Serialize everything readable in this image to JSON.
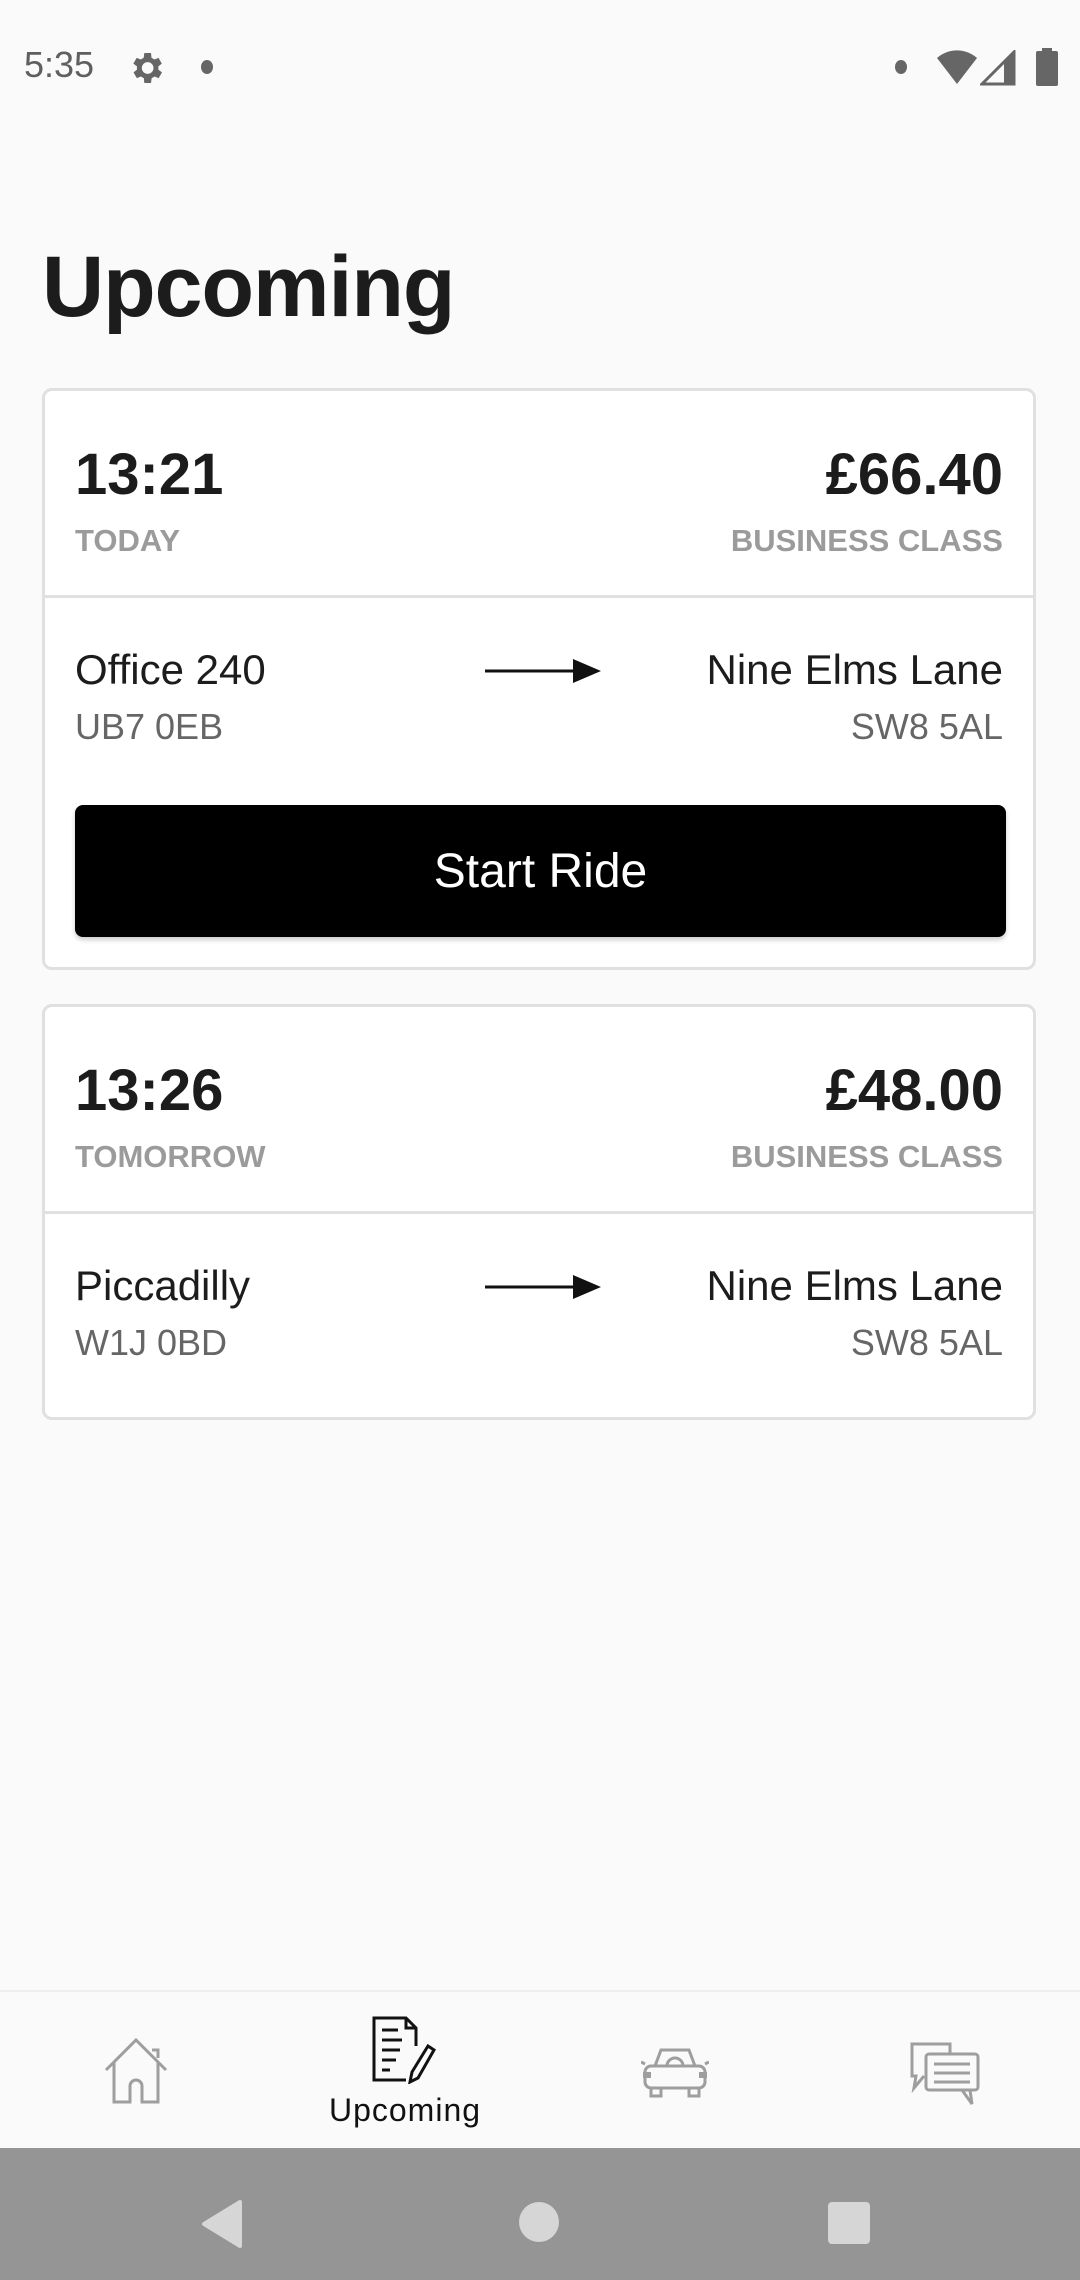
{
  "status_bar": {
    "time": "5:35",
    "icons": [
      "gear-icon",
      "notification-dot",
      "notification-dot",
      "wifi-icon",
      "signal-icon",
      "battery-icon"
    ]
  },
  "page": {
    "title": "Upcoming"
  },
  "rides": [
    {
      "time": "13:21",
      "day": "TODAY",
      "price": "£66.40",
      "class": "BUSINESS CLASS",
      "from": {
        "name": "Office 240",
        "postcode": "UB7 0EB"
      },
      "to": {
        "name": "Nine Elms Lane",
        "postcode": "SW8 5AL"
      },
      "action_label": "Start Ride"
    },
    {
      "time": "13:26",
      "day": "TOMORROW",
      "price": "£48.00",
      "class": "BUSINESS CLASS",
      "from": {
        "name": "Piccadilly",
        "postcode": "W1J 0BD"
      },
      "to": {
        "name": "Nine Elms Lane",
        "postcode": "SW8 5AL"
      }
    }
  ],
  "bottom_nav": {
    "items": [
      {
        "icon": "home-icon",
        "label": "",
        "active": false
      },
      {
        "icon": "document-edit-icon",
        "label": "Upcoming",
        "active": true
      },
      {
        "icon": "car-icon",
        "label": "",
        "active": false
      },
      {
        "icon": "chat-icon",
        "label": "",
        "active": false
      }
    ]
  },
  "colors": {
    "background": "#fafafa",
    "card": "#ffffff",
    "primary_button": "#000000",
    "muted_text": "#9b9b9b",
    "inactive_icon": "#9e9e9e",
    "system_nav": "#959595"
  }
}
